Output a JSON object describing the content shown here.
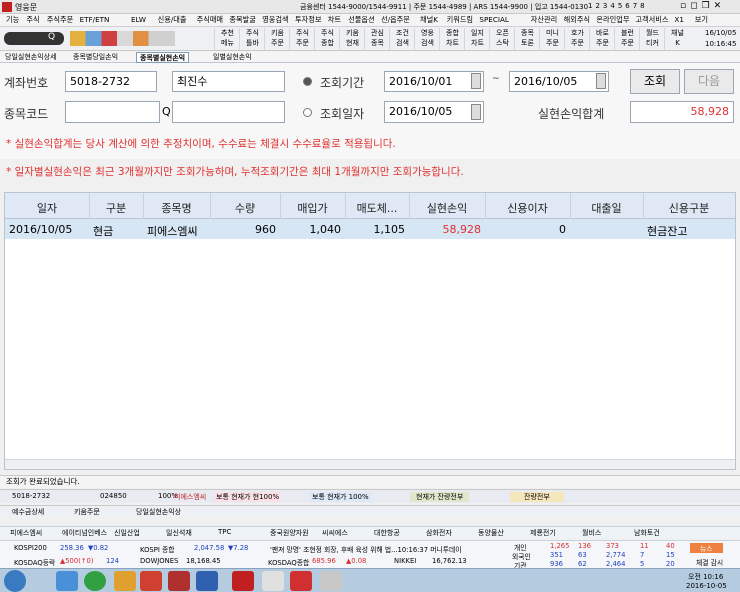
{
  "window": {
    "title": "영웅문",
    "info": "금융센터 1544-9000/1544-9911 | 주문 1544-4989 | ARS 1544-9900 | 입고 1544-0130",
    "pages": [
      "1",
      "2",
      "3",
      "4",
      "5",
      "6",
      "7",
      "8"
    ]
  },
  "menu": [
    "기능",
    "주식",
    "주식주문",
    "ETF/ETN",
    "ELW",
    "신용/대출",
    "주식매매",
    "종목발굴",
    "영웅검색",
    "투자정보",
    "차트",
    "선물옵션",
    "선/옵주문",
    "채널K",
    "키워드림",
    "SPECIAL",
    "자산관리",
    "해외주식",
    "온라인업무",
    "고객서비스",
    "X1",
    "보기"
  ],
  "toolbar": {
    "search_placeholder": "",
    "buttons": [
      [
        "추천",
        "메뉴"
      ],
      [
        "주식",
        "틀바"
      ],
      [
        "키움",
        "주문"
      ],
      [
        "주식",
        "주문"
      ],
      [
        "주식",
        "종합"
      ],
      [
        "키움",
        "현재"
      ],
      [
        "관심",
        "종목"
      ],
      [
        "조건",
        "검색"
      ],
      [
        "영웅",
        "검색"
      ],
      [
        "종합",
        "차트"
      ],
      [
        "일지",
        "차트"
      ],
      [
        "오픈",
        "스탁"
      ],
      [
        "종목",
        "토론"
      ],
      [
        "미니",
        "주문"
      ],
      [
        "호가",
        "주문"
      ],
      [
        "바로",
        "주문"
      ],
      [
        "블런",
        "주문"
      ],
      [
        "월드",
        "티커"
      ],
      [
        "채널",
        "K"
      ]
    ],
    "date": "16/10/05",
    "time": "10:16:45"
  },
  "tabs": [
    "당일실현손익상세",
    "종목별당일손익",
    "종목별실현손익",
    "일별실현손익"
  ],
  "form": {
    "account_label": "계좌번호",
    "account": "5018-2732",
    "account_name": "최진수",
    "period_label": "조회기간",
    "date_from": "2016/10/01",
    "tilde": "~",
    "date_to": "2016/10/05",
    "query": "조회",
    "next": "다음",
    "code_label": "종목코드",
    "code": "",
    "search_icon": "Q",
    "day_label": "조회일자",
    "day": "2016/10/05",
    "profit_label": "실현손익합계",
    "profit_total": "58,928"
  },
  "notes": [
    "* 실현손익합계는 당사 계산에 의한 추정치이며, 수수료는 체결시 수수료율로 적용됩니다.",
    "* 일자별실현손익은 최근 3개월까지만 조회가능하며, 누적조회기간은 최대 1개월까지만 조회가능합니다."
  ],
  "grid": {
    "headers": [
      "일자",
      "구분",
      "종목명",
      "수량",
      "매입가",
      "매도체...",
      "실현손익",
      "신용이자",
      "대출일",
      "신용구분"
    ],
    "rows": [
      [
        "2016/10/05",
        "현금",
        "피에스엠씨",
        "960",
        "1,040",
        "1,105",
        "58,928",
        "0",
        "",
        "현금잔고"
      ]
    ]
  },
  "status": "조회가 완료되었습니다.",
  "bar2": {
    "account": "5018-2732",
    "code": "024850",
    "pct": "100%",
    "name": "피에스엠씨",
    "t1": "보통 현재가 현100%",
    "t2": "보통 현재가 100%",
    "t3": "현재가 잔량전부",
    "t4": "잔량전부"
  },
  "bar3": [
    "예수금상세",
    "키움주문",
    "당일실현손익상"
  ],
  "stocks": [
    "피에스엠씨",
    "에이티넘인베스",
    "신일산업",
    "일신석재",
    "TPC",
    "중국원양자원",
    "씨씨에스",
    "대한항공",
    "삼화전자",
    "동양물산",
    "제룡전기",
    "월비스",
    "남화토건"
  ],
  "ticker": {
    "r1": [
      "KOSPI200",
      "258.36",
      "▼0.82",
      "KOSPI 종합",
      "2,047.58",
      "▼7.28",
      "'팬져 망명' 조현정 회장, 후배 육성 위해 법...10:16:37 머니투데이"
    ],
    "r2": [
      "KOSDAQ등락",
      "▲500(↑0)",
      "124",
      "DOWJONES",
      "18,168.45",
      "KOSDAQ종합",
      "685.96",
      "▲0.08",
      "NIKKEI",
      "16,762.13"
    ],
    "investor": [
      "개인",
      "외국인",
      "기관"
    ],
    "nums": [
      [
        "1,265",
        "136",
        "373",
        "11",
        "40"
      ],
      [
        "351",
        "63",
        "2,774",
        "7",
        "15"
      ],
      [
        "936",
        "62",
        "2,464",
        "5",
        "20"
      ]
    ],
    "news": "뉴스",
    "news2": "체결 감시"
  },
  "taskbar": {
    "time": "오전 10:16",
    "date": "2016-10-05"
  },
  "colors": {
    "red": "#e03030",
    "header": "#dfe8f4",
    "row": "#d6e6f4"
  }
}
